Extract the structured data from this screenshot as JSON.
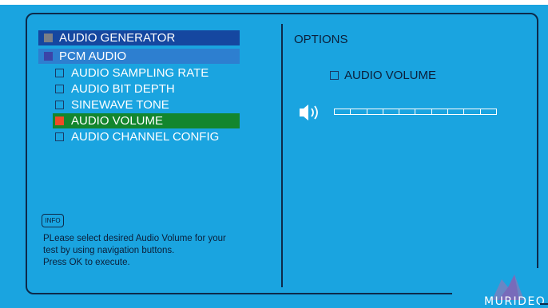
{
  "menu": {
    "generator": "AUDIO GENERATOR",
    "pcm": "PCM AUDIO",
    "items": [
      {
        "label": "AUDIO SAMPLING RATE",
        "selected": false
      },
      {
        "label": "AUDIO BIT DEPTH",
        "selected": false
      },
      {
        "label": "SINEWAVE TONE",
        "selected": false
      },
      {
        "label": "AUDIO VOLUME",
        "selected": true
      },
      {
        "label": "AUDIO CHANNEL CONFIG",
        "selected": false
      }
    ]
  },
  "options": {
    "title": "OPTIONS",
    "volume_label": "AUDIO VOLUME",
    "volume_level": 0,
    "volume_segments": 10
  },
  "info": {
    "button": "INFO",
    "lines": [
      "PLease select desired Audio Volume for your",
      "test by using navigation buttons.",
      "Press OK to execute."
    ]
  },
  "brand": "MURIDEO",
  "colors": {
    "background": "#1aa4e0",
    "selected": "#13862e",
    "header": "#1547a0",
    "accent": "#f04a26"
  }
}
